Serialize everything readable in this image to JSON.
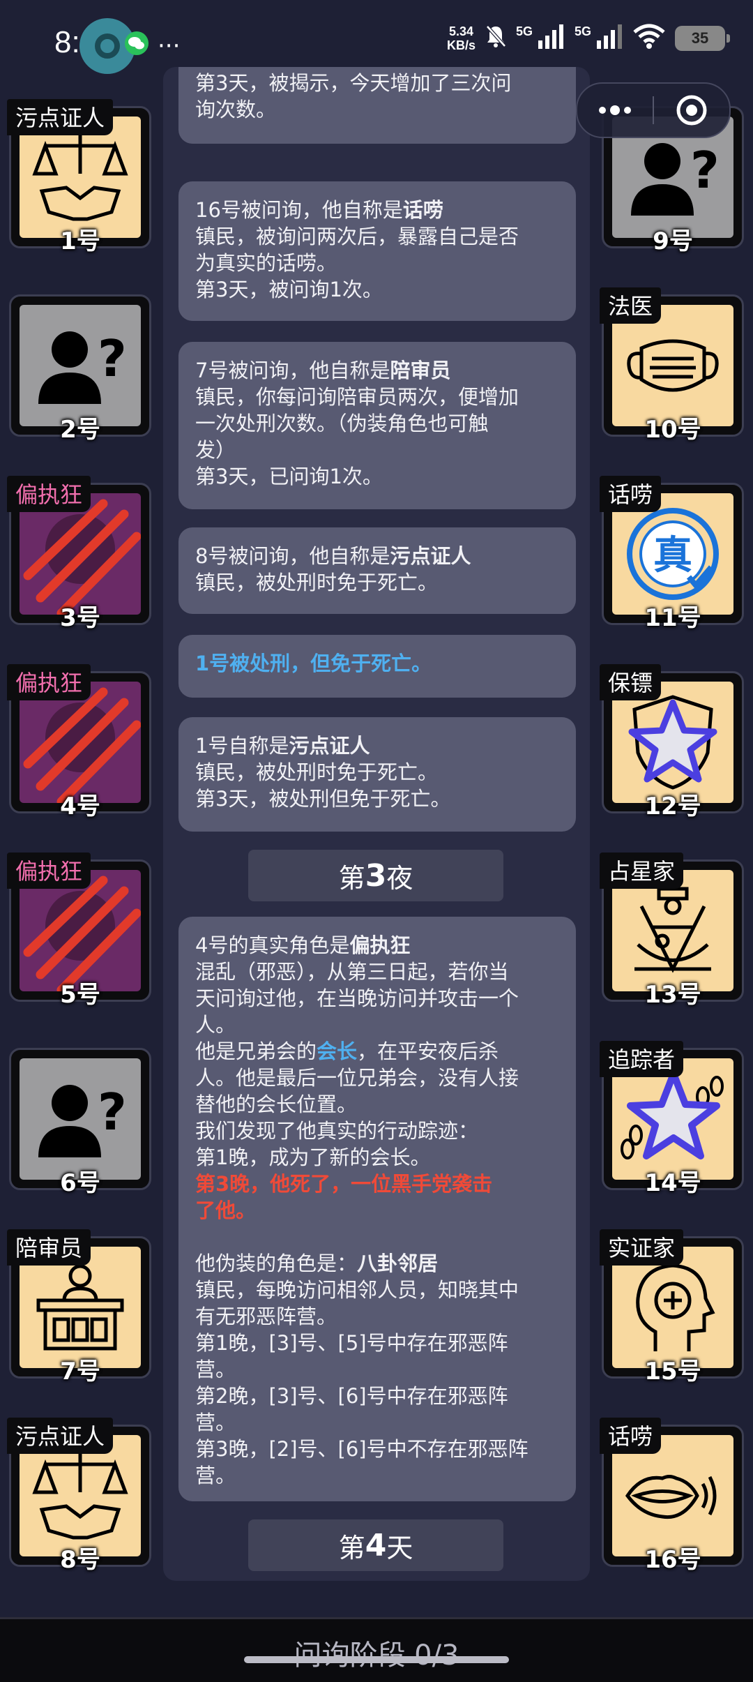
{
  "status": {
    "time": "8:23",
    "net_speed_top": "5.34",
    "net_speed_bottom": "KB/s",
    "sig1": "5G",
    "sig2": "5G",
    "battery": "35"
  },
  "players_left": [
    {
      "num": "1号",
      "role": "污点证人",
      "icon": "scales-handshake-icon"
    },
    {
      "num": "2号",
      "role": "",
      "icon": "unknown-person-icon"
    },
    {
      "num": "3号",
      "role": "偏执狂",
      "icon": "claw-scratch-icon"
    },
    {
      "num": "4号",
      "role": "偏执狂",
      "icon": "claw-scratch-icon"
    },
    {
      "num": "5号",
      "role": "偏执狂",
      "icon": "claw-scratch-icon"
    },
    {
      "num": "6号",
      "role": "",
      "icon": "unknown-person-icon"
    },
    {
      "num": "7号",
      "role": "陪审员",
      "icon": "juror-bench-icon"
    },
    {
      "num": "8号",
      "role": "污点证人",
      "icon": "scales-handshake-icon"
    }
  ],
  "players_right": [
    {
      "num": "9号",
      "role": "",
      "icon": "unknown-person-icon"
    },
    {
      "num": "10号",
      "role": "法医",
      "icon": "face-mask-icon"
    },
    {
      "num": "11号",
      "role": "话唠",
      "icon": "true-badge-icon"
    },
    {
      "num": "12号",
      "role": "保镖",
      "icon": "star-shield-icon"
    },
    {
      "num": "13号",
      "role": "占星家",
      "icon": "sextant-icon"
    },
    {
      "num": "14号",
      "role": "追踪者",
      "icon": "star-footprints-icon"
    },
    {
      "num": "15号",
      "role": "实证家",
      "icon": "head-plus-icon"
    },
    {
      "num": "16号",
      "role": "话唠",
      "icon": "mouth-sound-icon"
    }
  ],
  "log": {
    "e0": {
      "l1": "第3天，被揭示，今天增加了三次问",
      "l2": "询次数。"
    },
    "e1": {
      "a": "16号被问询，他自称是",
      "b": "话唠",
      "l2": "镇民，被询问两次后，暴露自己是否",
      "l3": "为真实的话唠。",
      "l4": "第3天，被问询1次。"
    },
    "e2": {
      "a": "7号被问询，他自称是",
      "b": "陪审员",
      "l2": "镇民，你每问询陪审员两次，便增加",
      "l3": "一次处刑次数。（伪装角色也可触",
      "l4": "发）",
      "l5": "第3天，已问询1次。"
    },
    "e3": {
      "a": "8号被问询，他自称是",
      "b": "污点证人",
      "l2": "镇民，被处刑时免于死亡。"
    },
    "e4": {
      "l1": "1号被处刑，但免于死亡。"
    },
    "e5": {
      "a": "1号自称是",
      "b": "污点证人",
      "l2": "镇民，被处刑时免于死亡。",
      "l3": "第3天，被处刑但免于死亡。"
    },
    "phase1": {
      "pre": "第",
      "num": "3",
      "post": "夜"
    },
    "e6": {
      "a": "4号的真实角色是",
      "b": "偏执狂",
      "l2": "混乱（邪恶），从第三日起，若你当",
      "l3": "天问询过他，在当晚访问并攻击一个",
      "l4": "人。",
      "l5a": "他是兄弟会的",
      "l5b": "会长",
      "l5c": "，在平安夜后杀",
      "l6": "人。他是最后一位兄弟会，没有人接",
      "l7": "替他的会长位置。",
      "l8": "我们发现了他真实的行动踪迹：",
      "l9": "第1晚，成为了新的会长。",
      "l10": "第3晚，他死了，一位黑手党袭击",
      "l11": "了他。",
      "l12a": "他伪装的角色是：",
      "l12b": "八卦邻居",
      "l13": "镇民，每晚访问相邻人员，知晓其中",
      "l14": "有无邪恶阵营。",
      "l15": "第1晚，[3]号、[5]号中存在邪恶阵",
      "l16": "营。",
      "l17": "第2晚，[3]号、[6]号中存在邪恶阵",
      "l18": "营。",
      "l19": "第3晚，[2]号、[6]号中不存在邪恶阵",
      "l20": "营。"
    },
    "phase2": {
      "pre": "第",
      "num": "4",
      "post": "天"
    }
  },
  "bottom": {
    "label": "问询阶段 0/3"
  }
}
